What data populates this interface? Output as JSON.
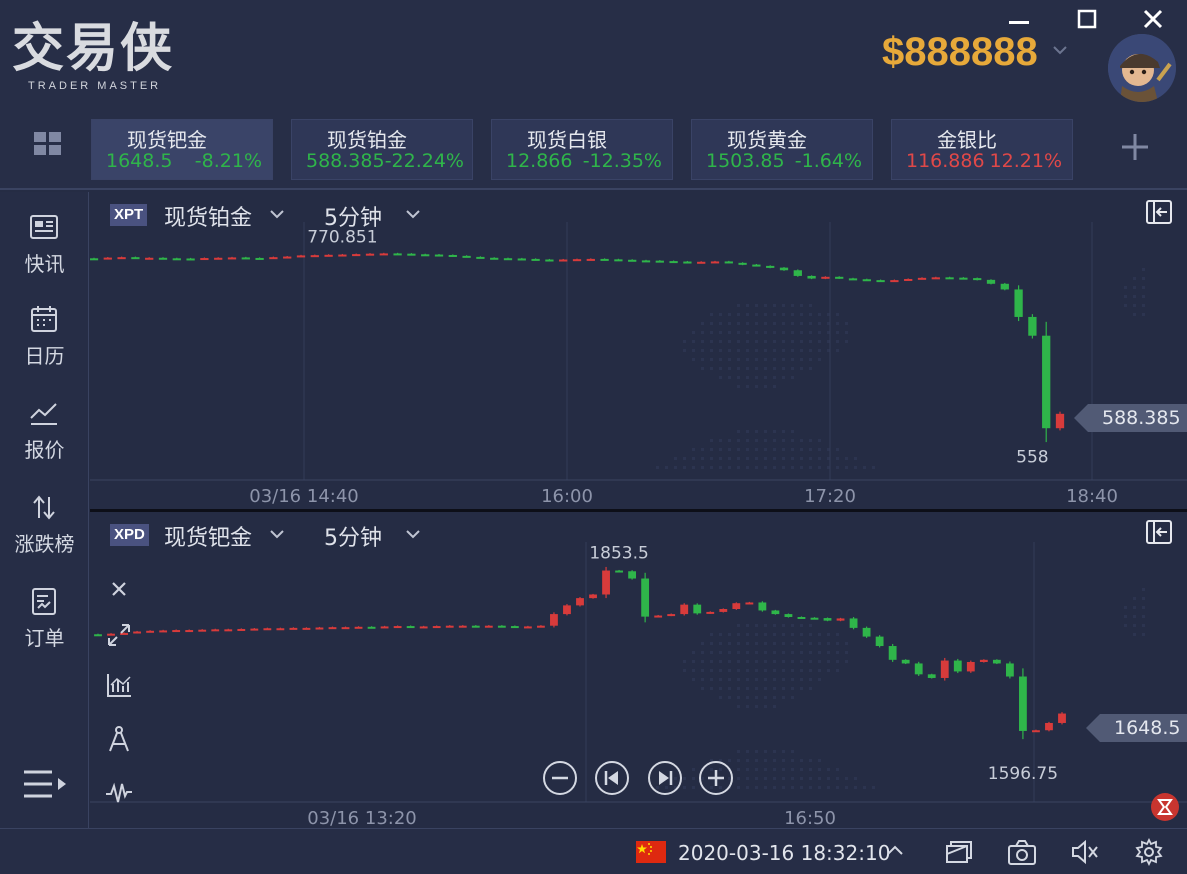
{
  "app": {
    "brand": "交易侠",
    "brand_sub": "TRADER MASTER",
    "balance": "$888888"
  },
  "quotes": [
    {
      "name": "现货钯金",
      "price": "1648.5",
      "change": "-8.21%",
      "color": "#2fb54a",
      "active": true
    },
    {
      "name": "现货铂金",
      "price": "588.385",
      "change": "-22.24%",
      "color": "#2fb54a",
      "active": false
    },
    {
      "name": "现货白银",
      "price": "12.866",
      "change": "-12.35%",
      "color": "#2fb54a",
      "active": false
    },
    {
      "name": "现货黄金",
      "price": "1503.85",
      "change": "-1.64%",
      "color": "#2fb54a",
      "active": false
    },
    {
      "name": "金银比",
      "price": "116.886",
      "change": "12.21%",
      "color": "#e04848",
      "active": false
    }
  ],
  "sidebar": {
    "items": [
      {
        "label": "快讯",
        "icon": "news-icon"
      },
      {
        "label": "日历",
        "icon": "calendar-icon"
      },
      {
        "label": "报价",
        "icon": "quote-icon"
      },
      {
        "label": "涨跌榜",
        "icon": "sort-icon"
      },
      {
        "label": "订单",
        "icon": "order-icon"
      }
    ]
  },
  "top_chart": {
    "symbol": "XPT",
    "name": "现货铂金",
    "timeframe": "5分钟",
    "last_price": "588.385",
    "high_label": "770.851",
    "low_label": "558",
    "x_labels": [
      "03/16 14:40",
      "16:00",
      "17:20",
      "18:40"
    ]
  },
  "bottom_chart": {
    "symbol": "XPD",
    "name": "现货钯金",
    "timeframe": "5分钟",
    "last_price": "1648.5",
    "high_label": "1853.5",
    "low_label": "1596.75",
    "x_labels": [
      "03/16 13:20",
      "16:50"
    ]
  },
  "statusbar": {
    "datetime": "2020-03-16 18:32:10"
  },
  "colors": {
    "up": "#e04848",
    "down": "#2fb54a",
    "balance": "#e7a93a"
  },
  "chart_data": [
    {
      "type": "candlestick",
      "title": "现货铂金",
      "timeframe": "5分钟",
      "x": [
        "03/16 14:40",
        "16:00",
        "17:20",
        "18:40"
      ],
      "annotations": {
        "high": 770.851,
        "low": 558,
        "last": 588.385
      },
      "closes": [
        764,
        765,
        765.5,
        764.5,
        764.8,
        764.2,
        764,
        763.8,
        764.5,
        764.8,
        765.2,
        764.6,
        764.3,
        765.5,
        766.2,
        767.5,
        767.8,
        768.2,
        768.5,
        769,
        769.5,
        769.8,
        769.5,
        768.8,
        768.5,
        768,
        767,
        765.8,
        764.8,
        764.3,
        764,
        763.5,
        762.8,
        762.5,
        762.8,
        763.2,
        763.5,
        763,
        762.5,
        761.8,
        761.5,
        761,
        760.5,
        759.8,
        760.2,
        760.6,
        759,
        757,
        755.5,
        753.5,
        750.5,
        744,
        741,
        743,
        741.2,
        740.2,
        739.2,
        738.4,
        739.2,
        740.5,
        741.8,
        742.4,
        742,
        741.5,
        739.5,
        735,
        728.5,
        697,
        675.5,
        569.5,
        586
      ]
    },
    {
      "type": "candlestick",
      "title": "现货钯金",
      "timeframe": "5分钟",
      "x": [
        "03/16 13:20",
        "16:50"
      ],
      "annotations": {
        "high": 1853.5,
        "low": 1596.75,
        "last": 1648.5
      },
      "closes": [
        1763,
        1764,
        1765,
        1767,
        1768,
        1768.5,
        1769,
        1769,
        1769.5,
        1770,
        1770,
        1770.5,
        1771,
        1771.5,
        1771.5,
        1772,
        1772,
        1772.5,
        1773,
        1773,
        1773.5,
        1773,
        1774,
        1774.5,
        1774,
        1774,
        1774.5,
        1775,
        1775,
        1774.5,
        1775,
        1774.5,
        1774,
        1774,
        1775,
        1791,
        1803,
        1813,
        1818,
        1851,
        1850,
        1840,
        1787.5,
        1789,
        1791,
        1804,
        1792,
        1794,
        1798,
        1806,
        1807,
        1796,
        1791,
        1787,
        1786,
        1785.5,
        1782,
        1785,
        1772,
        1760,
        1747,
        1728,
        1723,
        1708,
        1703,
        1727,
        1712,
        1725,
        1728,
        1723,
        1705,
        1630,
        1631,
        1641,
        1654
      ]
    }
  ]
}
